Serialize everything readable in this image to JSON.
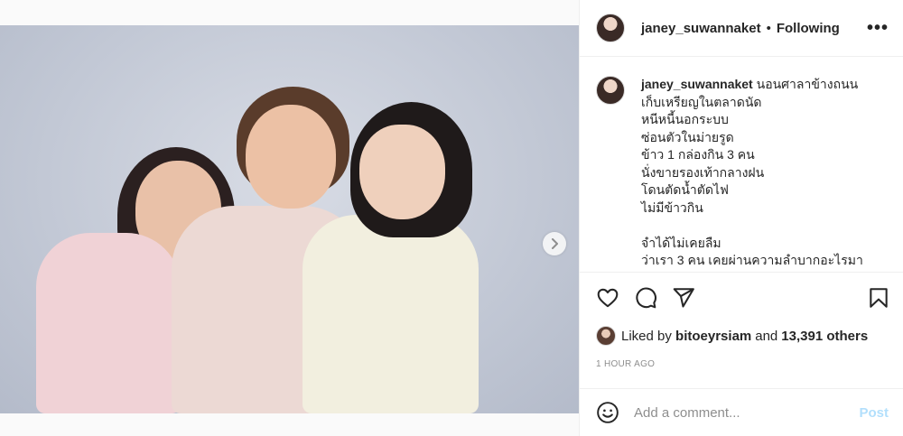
{
  "post": {
    "username": "janey_suwannaket",
    "separator": "•",
    "follow_status": "Following",
    "more_label": "•••"
  },
  "caption": {
    "username": "janey_suwannaket",
    "lines": [
      "นอนศาลาข้างถนน",
      "เก็บเหรียญในตลาดนัด",
      "หนีหนี้นอกระบบ",
      "ซ่อนตัวในม่ายรูด",
      "ข้าว 1 กล่องกิน 3 คน",
      "นั่งขายรองเท้ากลางฝน",
      "โดนตัดน้ำตัดไฟ",
      "ไม่มีข้าวกิน",
      "",
      "จำได้ไม่เคยลืม",
      "ว่าเรา 3 คน เคยผ่านความลำบากอะไรมา"
    ]
  },
  "likes": {
    "prefix": "Liked by",
    "liker": "bitoeyrsiam",
    "and": "and",
    "others": "13,391 others"
  },
  "timestamp": "1 HOUR AGO",
  "comment": {
    "placeholder": "Add a comment...",
    "post_label": "Post"
  },
  "colors": {
    "accent": "#0095f6",
    "post_disabled": "#b2dffc",
    "muted": "#8e8e8e"
  },
  "icons": [
    "heart-icon",
    "comment-icon",
    "share-icon",
    "bookmark-icon",
    "emoji-icon",
    "chevron-right-icon"
  ]
}
